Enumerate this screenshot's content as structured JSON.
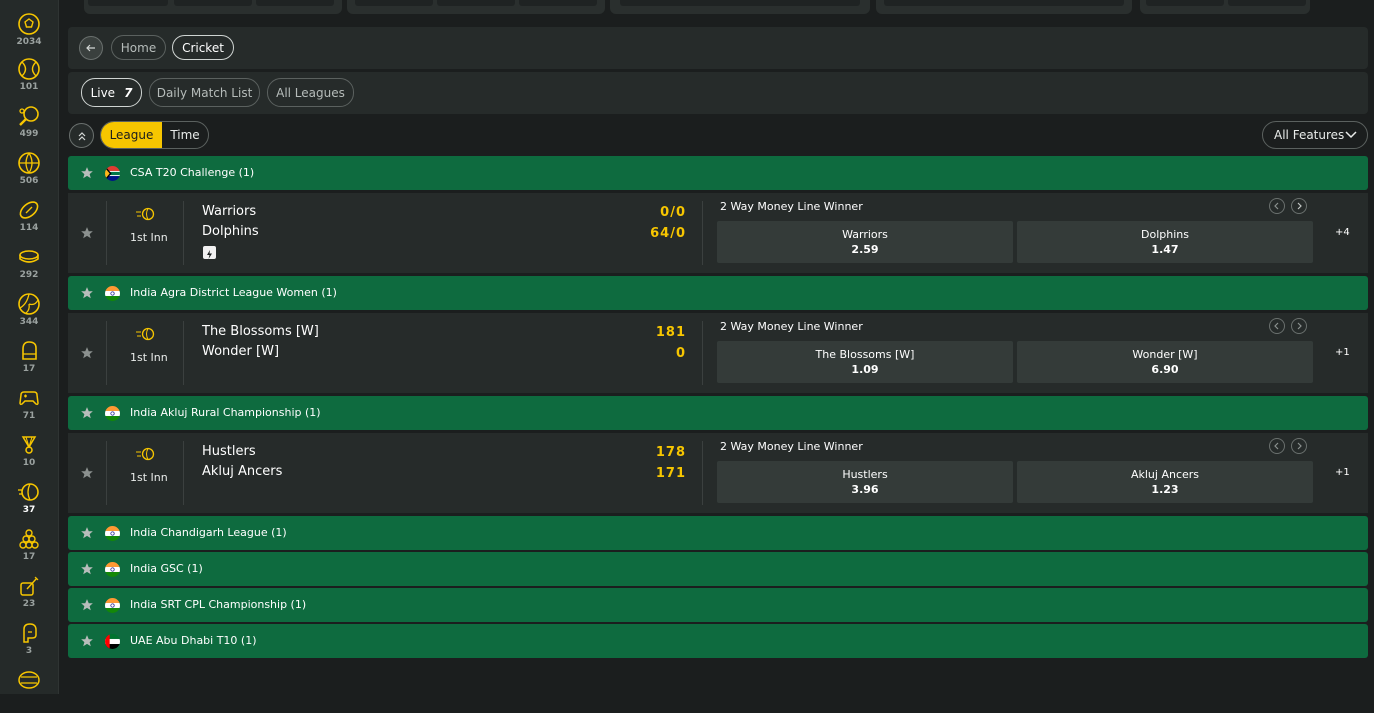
{
  "sidebar": {
    "sports": [
      {
        "icon": "soccer-ball-icon",
        "count": "2034"
      },
      {
        "icon": "tennis-ball-icon",
        "count": "101"
      },
      {
        "icon": "table-tennis-icon",
        "count": "499"
      },
      {
        "icon": "basketball-icon",
        "count": "506"
      },
      {
        "icon": "american-football-icon",
        "count": "114"
      },
      {
        "icon": "ice-hockey-icon",
        "count": "292"
      },
      {
        "icon": "volleyball-icon",
        "count": "344"
      },
      {
        "icon": "mma-glove-icon",
        "count": "17"
      },
      {
        "icon": "esports-controller-icon",
        "count": "71"
      },
      {
        "icon": "badminton-shuttlecock-icon",
        "count": "10"
      },
      {
        "icon": "cricket-ball-icon",
        "count": "37"
      },
      {
        "icon": "snooker-icon",
        "count": "17"
      },
      {
        "icon": "darts-icon",
        "count": "23"
      },
      {
        "icon": "boxing-icon",
        "count": "3"
      },
      {
        "icon": "handball-icon",
        "count": ""
      }
    ]
  },
  "breadcrumb": {
    "home": "Home",
    "current": "Cricket"
  },
  "tabs": {
    "live_label": "Live",
    "live_count": "7",
    "daily": "Daily Match List",
    "all_leagues": "All Leagues"
  },
  "sort": {
    "league": "League",
    "time": "Time",
    "features": "All Features"
  },
  "leagues": [
    {
      "name": "CSA T20 Challenge (1)",
      "flag": "south-africa"
    },
    {
      "name": "India Agra District League Women (1)",
      "flag": "india"
    },
    {
      "name": "India Akluj Rural Championship (1)",
      "flag": "india"
    },
    {
      "name": "India Chandigarh League (1)",
      "flag": "india"
    },
    {
      "name": "India GSC (1)",
      "flag": "india"
    },
    {
      "name": "India SRT CPL Championship (1)",
      "flag": "india"
    },
    {
      "name": "UAE Abu Dhabi T10 (1)",
      "flag": "uae"
    }
  ],
  "matches": [
    {
      "inning": "1st Inn",
      "team1": "Warriors",
      "team2": "Dolphins",
      "score1": "0/0",
      "score2": "64/0",
      "market": "2 Way Money Line Winner",
      "odd1_name": "Warriors",
      "odd1_value": "2.59",
      "odd2_name": "Dolphins",
      "odd2_value": "1.47",
      "more": "+4"
    },
    {
      "inning": "1st Inn",
      "team1": "The Blossoms [W]",
      "team2": "Wonder [W]",
      "score1": "181",
      "score2": "0",
      "market": "2 Way Money Line Winner",
      "odd1_name": "The Blossoms [W]",
      "odd1_value": "1.09",
      "odd2_name": "Wonder [W]",
      "odd2_value": "6.90",
      "more": "+1"
    },
    {
      "inning": "1st Inn",
      "team1": "Hustlers",
      "team2": "Akluj Ancers",
      "score1": "178",
      "score2": "171",
      "market": "2 Way Money Line Winner",
      "odd1_name": "Hustlers",
      "odd1_value": "3.96",
      "odd2_name": "Akluj Ancers",
      "odd2_value": "1.23",
      "more": "+1"
    }
  ],
  "colors": {
    "accent": "#f7c600",
    "league_bg": "#0e6b3f",
    "panel": "#262b2a",
    "background": "#1b1e1e"
  }
}
